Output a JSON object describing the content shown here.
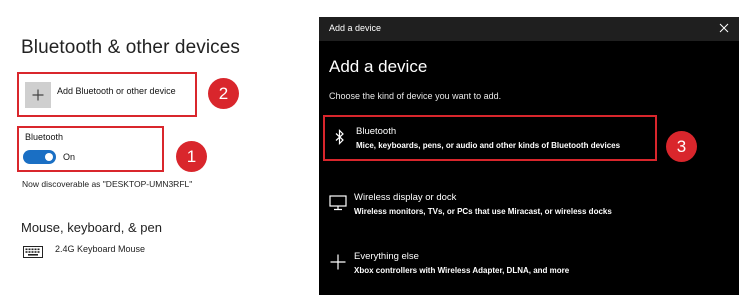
{
  "settings": {
    "page_title": "Bluetooth & other devices",
    "add_device_label": "Add Bluetooth or other device",
    "bluetooth_caption": "Bluetooth",
    "bluetooth_toggle_state": "On",
    "bluetooth_on": true,
    "discoverable_text": "Now discoverable as \"DESKTOP-UMN3RFL\"",
    "section_heading": "Mouse, keyboard, & pen",
    "devices": [
      {
        "name": "2.4G Keyboard Mouse",
        "icon": "keyboard-icon"
      }
    ]
  },
  "callouts": [
    "1",
    "2",
    "3"
  ],
  "dialog": {
    "window_title": "Add a device",
    "heading": "Add a device",
    "subtitle": "Choose the kind of device you want to add.",
    "options": [
      {
        "title": "Bluetooth",
        "description": "Mice, keyboards, pens, or audio and other kinds of Bluetooth devices",
        "icon": "bluetooth-icon"
      },
      {
        "title": "Wireless display or dock",
        "description": "Wireless monitors, TVs, or PCs that use Miracast, or wireless docks",
        "icon": "monitor-icon"
      },
      {
        "title": "Everything else",
        "description": "Xbox controllers with Wireless Adapter, DLNA, and more",
        "icon": "plus-icon"
      }
    ]
  },
  "colors": {
    "highlight_red": "#d9262c",
    "toggle_blue": "#1a6fc4",
    "dialog_bg": "#000000",
    "titlebar_bg": "#1f1f1f"
  }
}
